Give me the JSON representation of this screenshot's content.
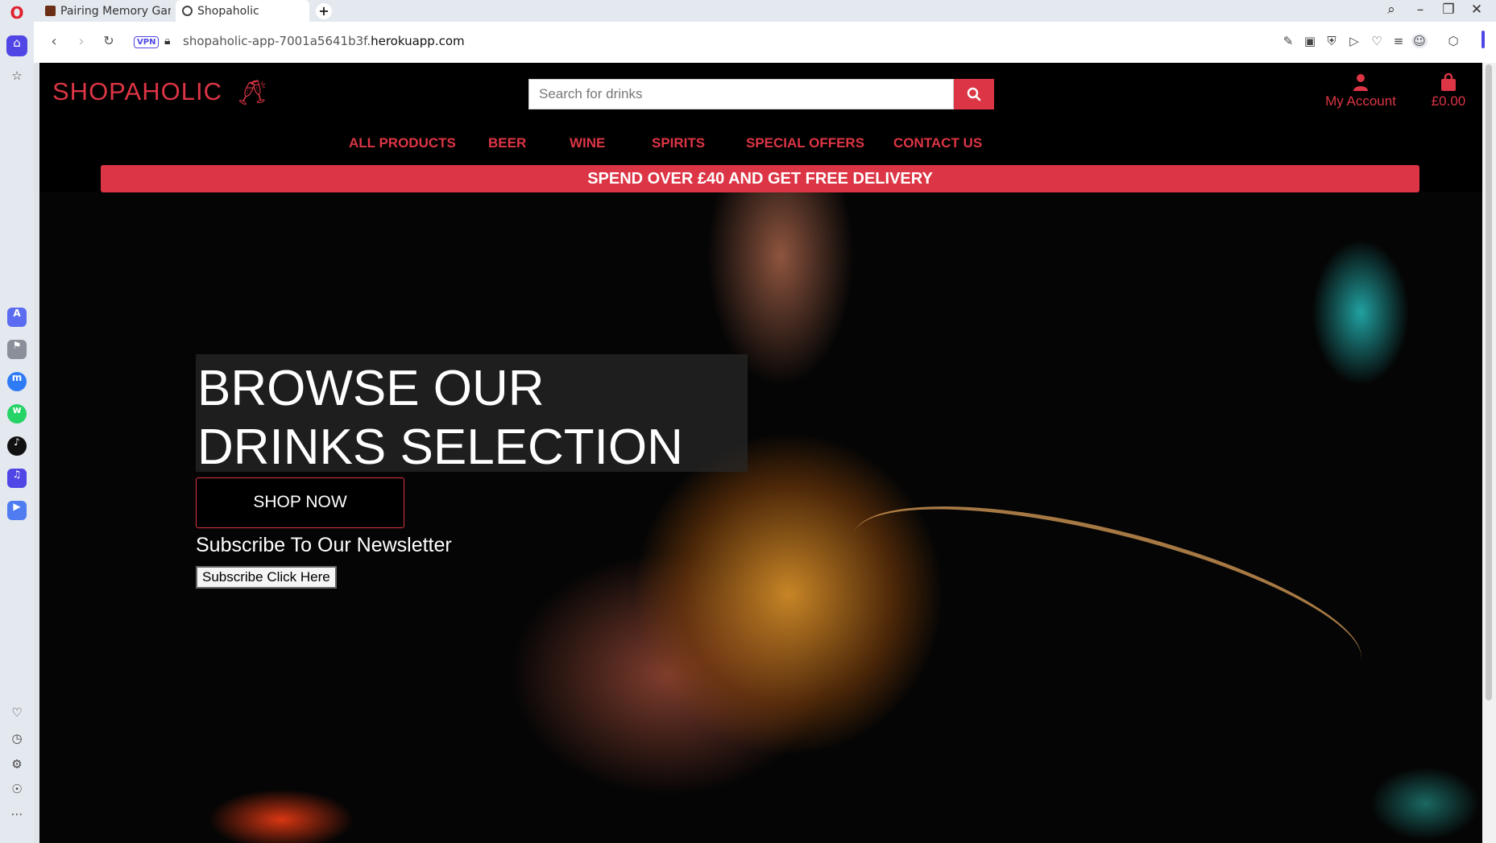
{
  "browser": {
    "tabs": [
      {
        "title": "Pairing Memory Gam",
        "active": false
      },
      {
        "title": "Shopaholic",
        "active": true
      }
    ],
    "url_prefix": "shopaholic-app-7001a5641b3f.",
    "url_domain": "herokuapp.com",
    "vpn_label": "VPN"
  },
  "site": {
    "logo": "SHOPAHOLIC",
    "logo_icon": "glasses-cheers-icon",
    "search_placeholder": "Search for drinks",
    "account_label": "My Account",
    "cart_total": "£0.00",
    "nav": [
      "ALL PRODUCTS",
      "BEER",
      "WINE",
      "SPIRITS",
      "SPECIAL OFFERS",
      "CONTACT US"
    ],
    "banner": "SPEND OVER £40 AND GET FREE DELIVERY",
    "hero": {
      "headline_line1": "BROWSE OUR",
      "headline_line2": "DRINKS SELECTION",
      "cta": "SHOP NOW",
      "newsletter_heading": "Subscribe To Our Newsletter",
      "subscribe_button": "Subscribe Click Here"
    }
  },
  "colors": {
    "brand": "#dc3545",
    "browser_accent": "#4f46e5"
  }
}
